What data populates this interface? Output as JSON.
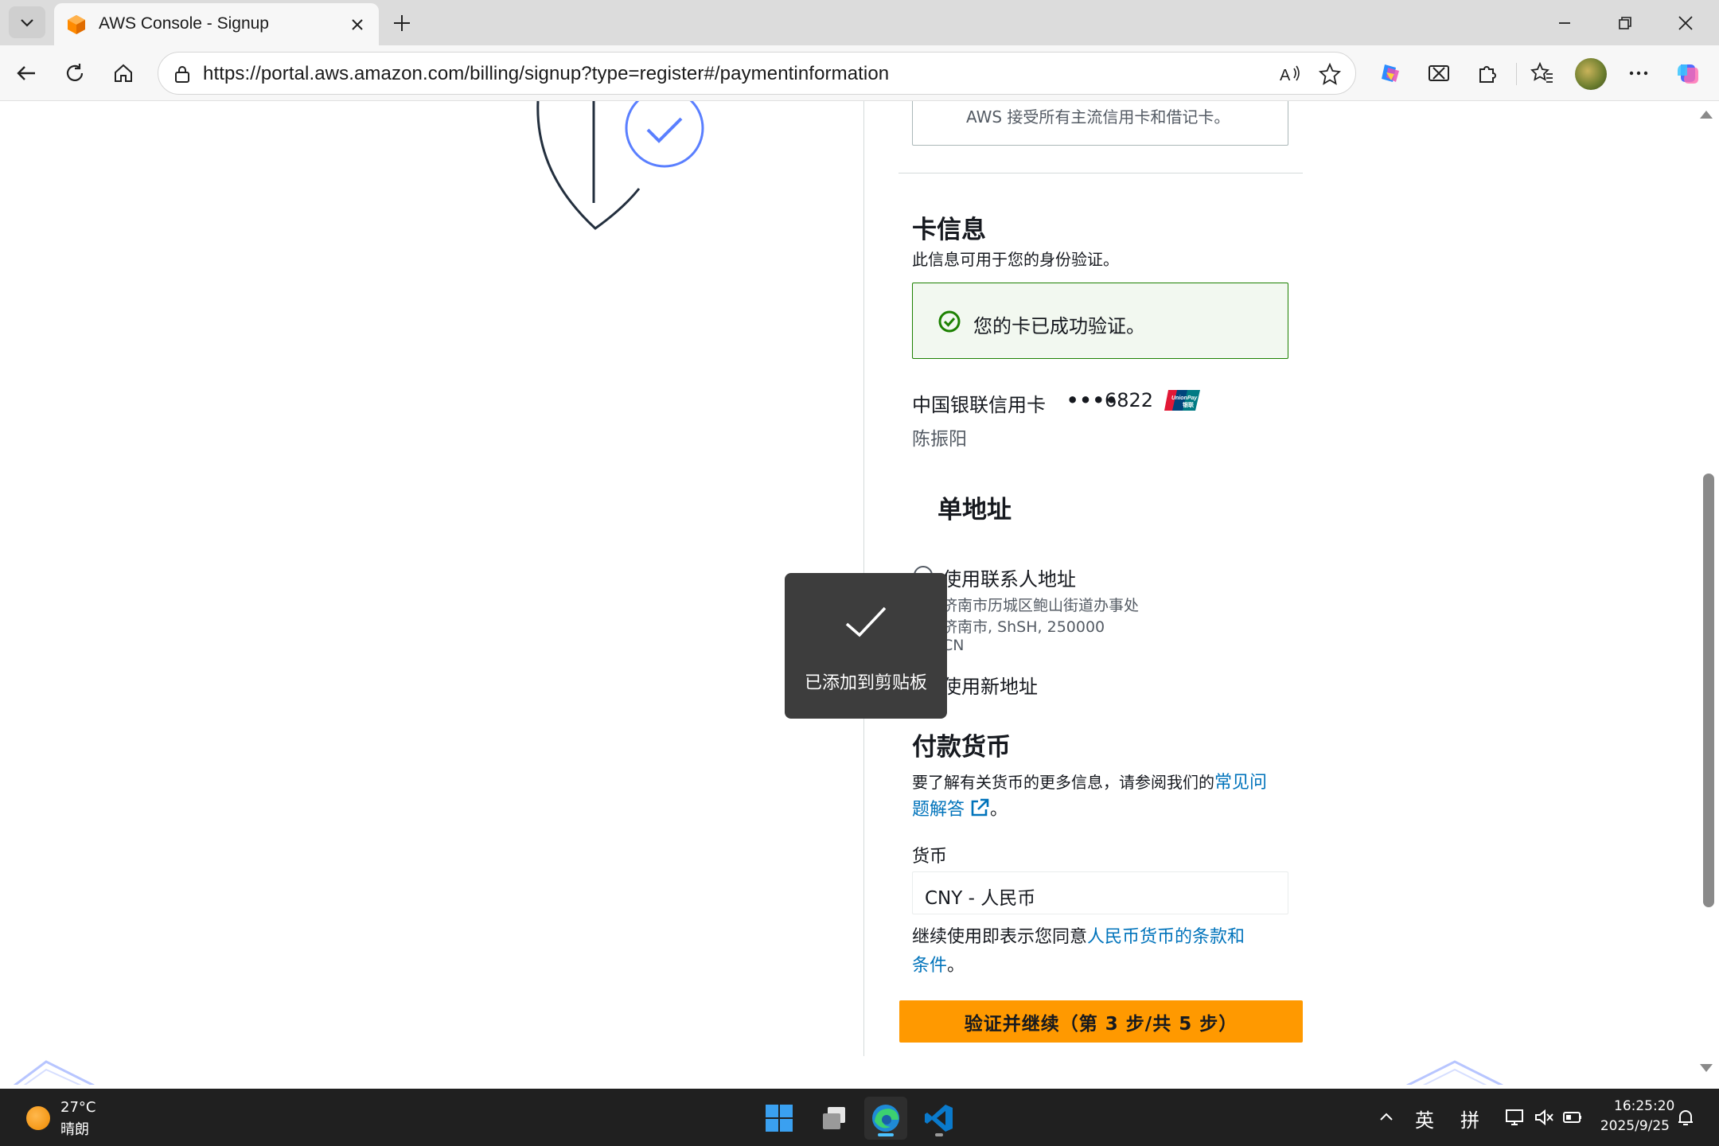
{
  "browser": {
    "tab_title": "AWS Console - Signup",
    "url": "https://portal.aws.amazon.com/billing/signup?type=register#/paymentinformation",
    "icons": [
      "tab-actions-icon",
      "aws-favicon-icon",
      "close-tab-icon",
      "new-tab-icon",
      "minimize-icon",
      "restore-icon",
      "close-window-icon",
      "back-icon",
      "refresh-icon",
      "home-icon",
      "lock-icon",
      "read-aloud-icon",
      "favorite-star-icon",
      "copilot-icon",
      "screenshot-icon",
      "extensions-icon",
      "favorites-icon",
      "profile-avatar",
      "more-icon",
      "edge-copilot-icon"
    ]
  },
  "page": {
    "previous_box_text": "AWS 接受所有主流信用卡和借记卡。",
    "card_info": {
      "heading": "卡信息",
      "subtitle": "此信息可用于您的身份验证。",
      "success_message": "您的卡已成功验证。",
      "card_type": "中国银联信用卡",
      "card_mask": "••••",
      "card_last4": "6822",
      "card_holder": "陈振阳",
      "brand_logo": "unionpay-logo"
    },
    "billing_address": {
      "heading": "单地址",
      "use_contact_label": "使用联系人地址",
      "address_line1": "济南市历城区鲍山街道办事处",
      "address_line2": "济南市, ShSH, 250000",
      "address_line3": "CN",
      "use_new_label": "使用新地址"
    },
    "currency": {
      "heading": "付款货币",
      "info_prefix": "要了解有关货币的更多信息，请参阅我们的",
      "info_link_part1": "常见问",
      "info_link_part2": "题解答",
      "info_suffix": "。",
      "field_label": "货币",
      "selected_value": "CNY - 人民币",
      "terms_prefix": "继续使用即表示您同意",
      "terms_link_part1": "人民币货币的条款和",
      "terms_link_part2": "条件",
      "terms_suffix": "。"
    },
    "continue_button": "验证并继续（第 3 步/共 5 步）",
    "toast": "已添加到剪贴板"
  },
  "taskbar": {
    "temperature": "27°C",
    "condition": "晴朗",
    "apps": [
      "windows-start-icon",
      "task-view-icon",
      "edge-browser-icon",
      "vscode-icon"
    ],
    "ime_lang": "英",
    "ime_mode": "拼",
    "time": "16:25:20",
    "date": "2025/9/25"
  },
  "colors": {
    "primary_button": "#ff9900",
    "link": "#0073bb",
    "success_border": "#1d8102",
    "success_bg": "#f2f8f0",
    "toast_bg": "#3d3d3d"
  }
}
